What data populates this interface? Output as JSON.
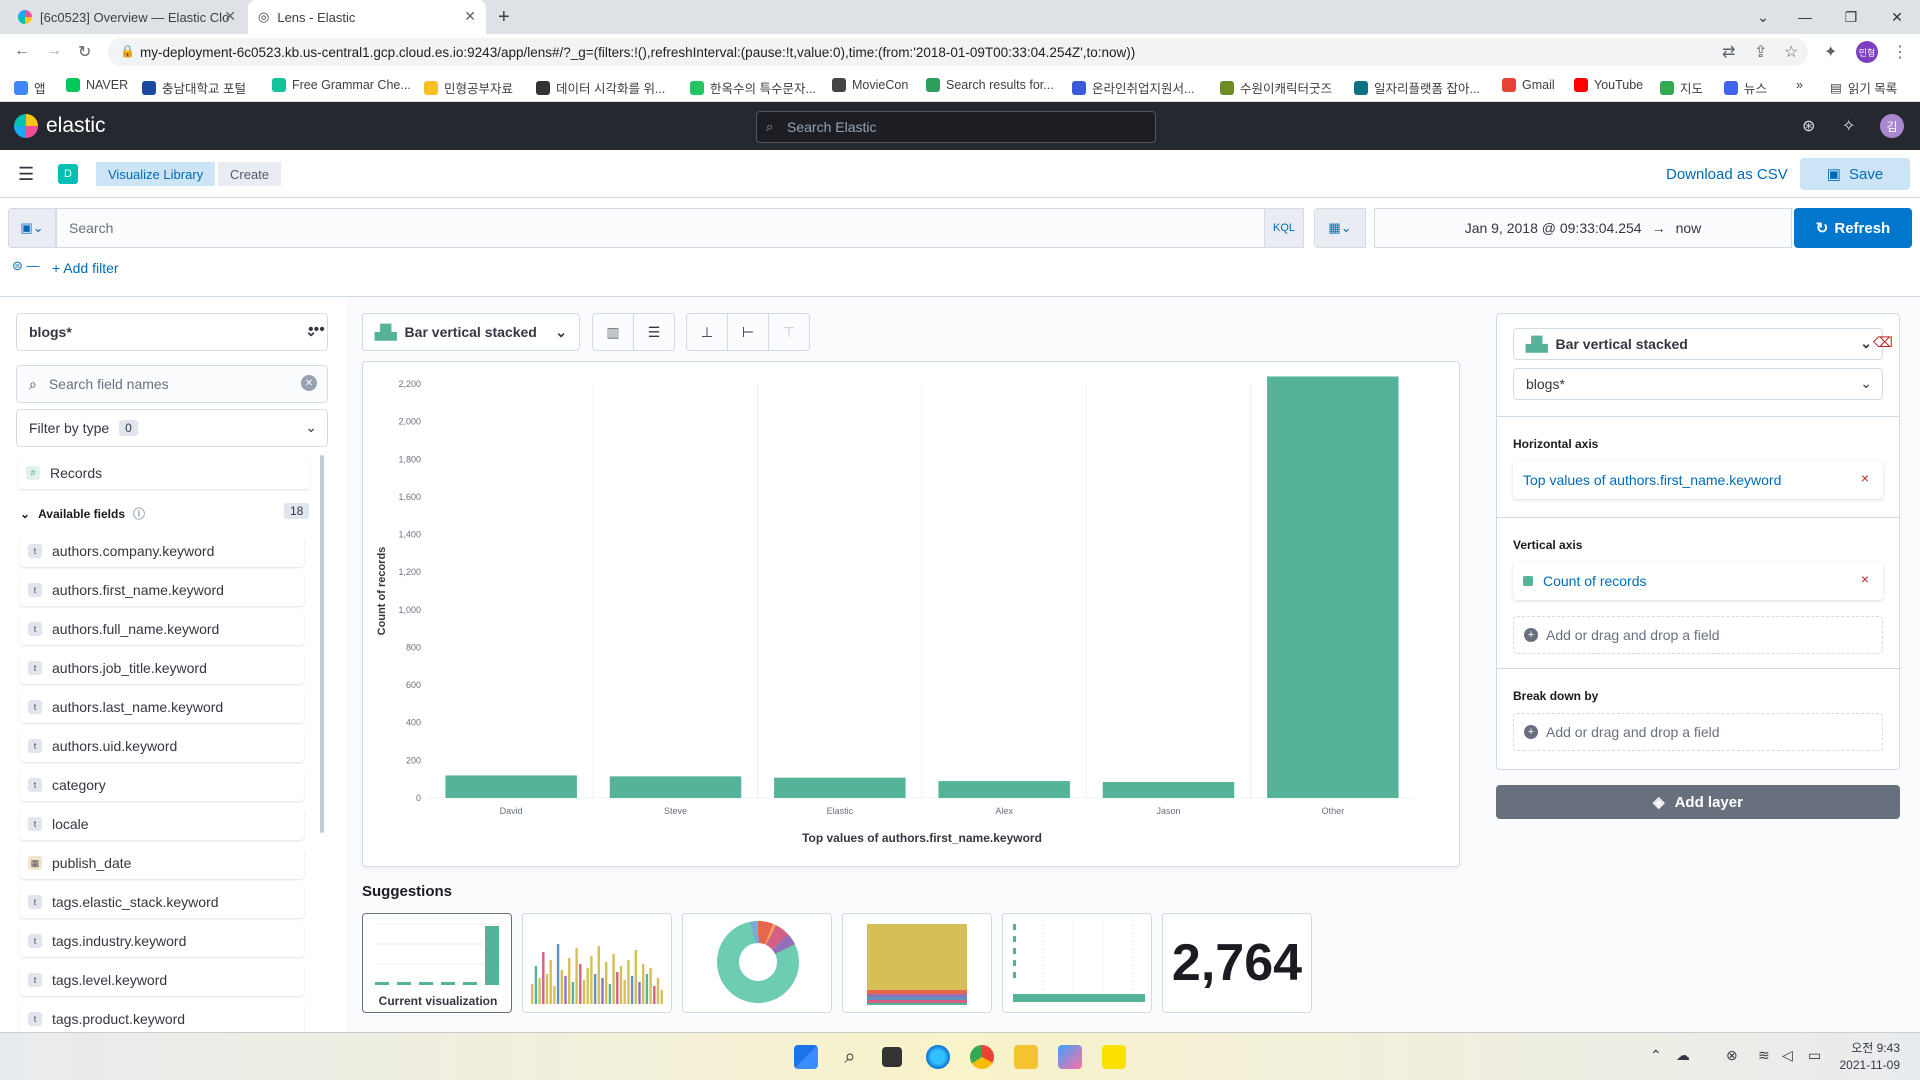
{
  "browser": {
    "tabs": [
      {
        "title": "[6c0523] Overview — Elastic Clo",
        "active": false
      },
      {
        "title": "Lens - Elastic",
        "active": true
      }
    ],
    "new_tab": "+",
    "url": "my-deployment-6c0523.kb.us-central1.gcp.cloud.es.io:9243/app/lens#/?_g=(filters:!(),refreshInterval:(pause:!t,value:0),time:(from:'2018-01-09T00:33:04.254Z',to:now))",
    "profile": "민형",
    "bookmarks": [
      {
        "label": "앱",
        "color": "#4285f4"
      },
      {
        "label": "NAVER",
        "color": "#03c75a"
      },
      {
        "label": "충남대학교 포털",
        "color": "#1a4aa0"
      },
      {
        "label": "Free Grammar Che...",
        "color": "#15c39a"
      },
      {
        "label": "민형공부자료",
        "color": "#f6c026"
      },
      {
        "label": "데이터 시각화를 위...",
        "color": "#333333"
      },
      {
        "label": "한옥수의 특수문자...",
        "color": "#22c55e"
      },
      {
        "label": "MovieCon",
        "color": "#444444"
      },
      {
        "label": "Search results for...",
        "color": "#2e9e5b"
      },
      {
        "label": "온라인취업지원서...",
        "color": "#3b5bdb"
      },
      {
        "label": "수원이캐릭터굿즈",
        "color": "#6b8e23"
      },
      {
        "label": "일자리플랫폼 잡아...",
        "color": "#0b7285"
      },
      {
        "label": "Gmail",
        "color": "#ea4335"
      },
      {
        "label": "YouTube",
        "color": "#ff0000"
      },
      {
        "label": "지도",
        "color": "#34a853"
      },
      {
        "label": "뉴스",
        "color": "#4263eb"
      }
    ],
    "bookmarks_more": "»",
    "reading_list": "읽기 목록"
  },
  "kibana": {
    "brand": "elastic",
    "search_placeholder": "Search Elastic",
    "space_badge": "D",
    "user_initial": "김",
    "breadcrumbs": [
      "Visualize Library",
      "Create"
    ],
    "download_csv": "Download as CSV",
    "save": "Save",
    "query_placeholder": "Search",
    "kql": "KQL",
    "date_from": "Jan 9, 2018 @ 09:33:04.254",
    "date_arrow": "→",
    "date_to": "now",
    "refresh": "Refresh",
    "add_filter": "+ Add filter"
  },
  "left_panel": {
    "index_pattern": "blogs*",
    "search_fields_placeholder": "Search field names",
    "filter_by_type": "Filter by type",
    "filter_count": "0",
    "records": "Records",
    "available_fields": "Available fields",
    "available_count": "18",
    "fields": [
      {
        "name": "authors.company.keyword",
        "type": "t"
      },
      {
        "name": "authors.first_name.keyword",
        "type": "t"
      },
      {
        "name": "authors.full_name.keyword",
        "type": "t"
      },
      {
        "name": "authors.job_title.keyword",
        "type": "t"
      },
      {
        "name": "authors.last_name.keyword",
        "type": "t"
      },
      {
        "name": "authors.uid.keyword",
        "type": "t"
      },
      {
        "name": "category",
        "type": "t"
      },
      {
        "name": "locale",
        "type": "t"
      },
      {
        "name": "publish_date",
        "type": "date"
      },
      {
        "name": "tags.elastic_stack.keyword",
        "type": "t"
      },
      {
        "name": "tags.industry.keyword",
        "type": "t"
      },
      {
        "name": "tags.level.keyword",
        "type": "t"
      },
      {
        "name": "tags.product.keyword",
        "type": "t"
      }
    ]
  },
  "workspace": {
    "chart_type": "Bar vertical stacked",
    "suggestions_title": "Suggestions",
    "suggestions": [
      "Current visualization",
      "",
      "",
      "",
      "",
      "2,764"
    ]
  },
  "chart_data": {
    "type": "bar",
    "categories": [
      "David",
      "Steve",
      "Elastic",
      "Alex",
      "Jason",
      "Other"
    ],
    "values": [
      120,
      115,
      108,
      90,
      85,
      2240
    ],
    "xlabel": "Top values of authors.first_name.keyword",
    "ylabel": "Count of records",
    "yticks": [
      "0",
      "200",
      "400",
      "600",
      "800",
      "1,000",
      "1,200",
      "1,400",
      "1,600",
      "1,800",
      "2,000",
      "2,200"
    ],
    "ylim": [
      0,
      2200
    ],
    "color": "#54b399",
    "grid": "vertical"
  },
  "right_panel": {
    "chart_type": "Bar vertical stacked",
    "index_pattern": "blogs*",
    "horizontal_axis_label": "Horizontal axis",
    "horizontal_axis_value": "Top values of authors.first_name.keyword",
    "vertical_axis_label": "Vertical axis",
    "vertical_axis_value": "Count of records",
    "add_field": "Add or drag and drop a field",
    "break_down_label": "Break down by",
    "add_layer": "Add layer",
    "remove": "×"
  },
  "taskbar": {
    "time": "오전 9:43",
    "date": "2021-11-09"
  }
}
